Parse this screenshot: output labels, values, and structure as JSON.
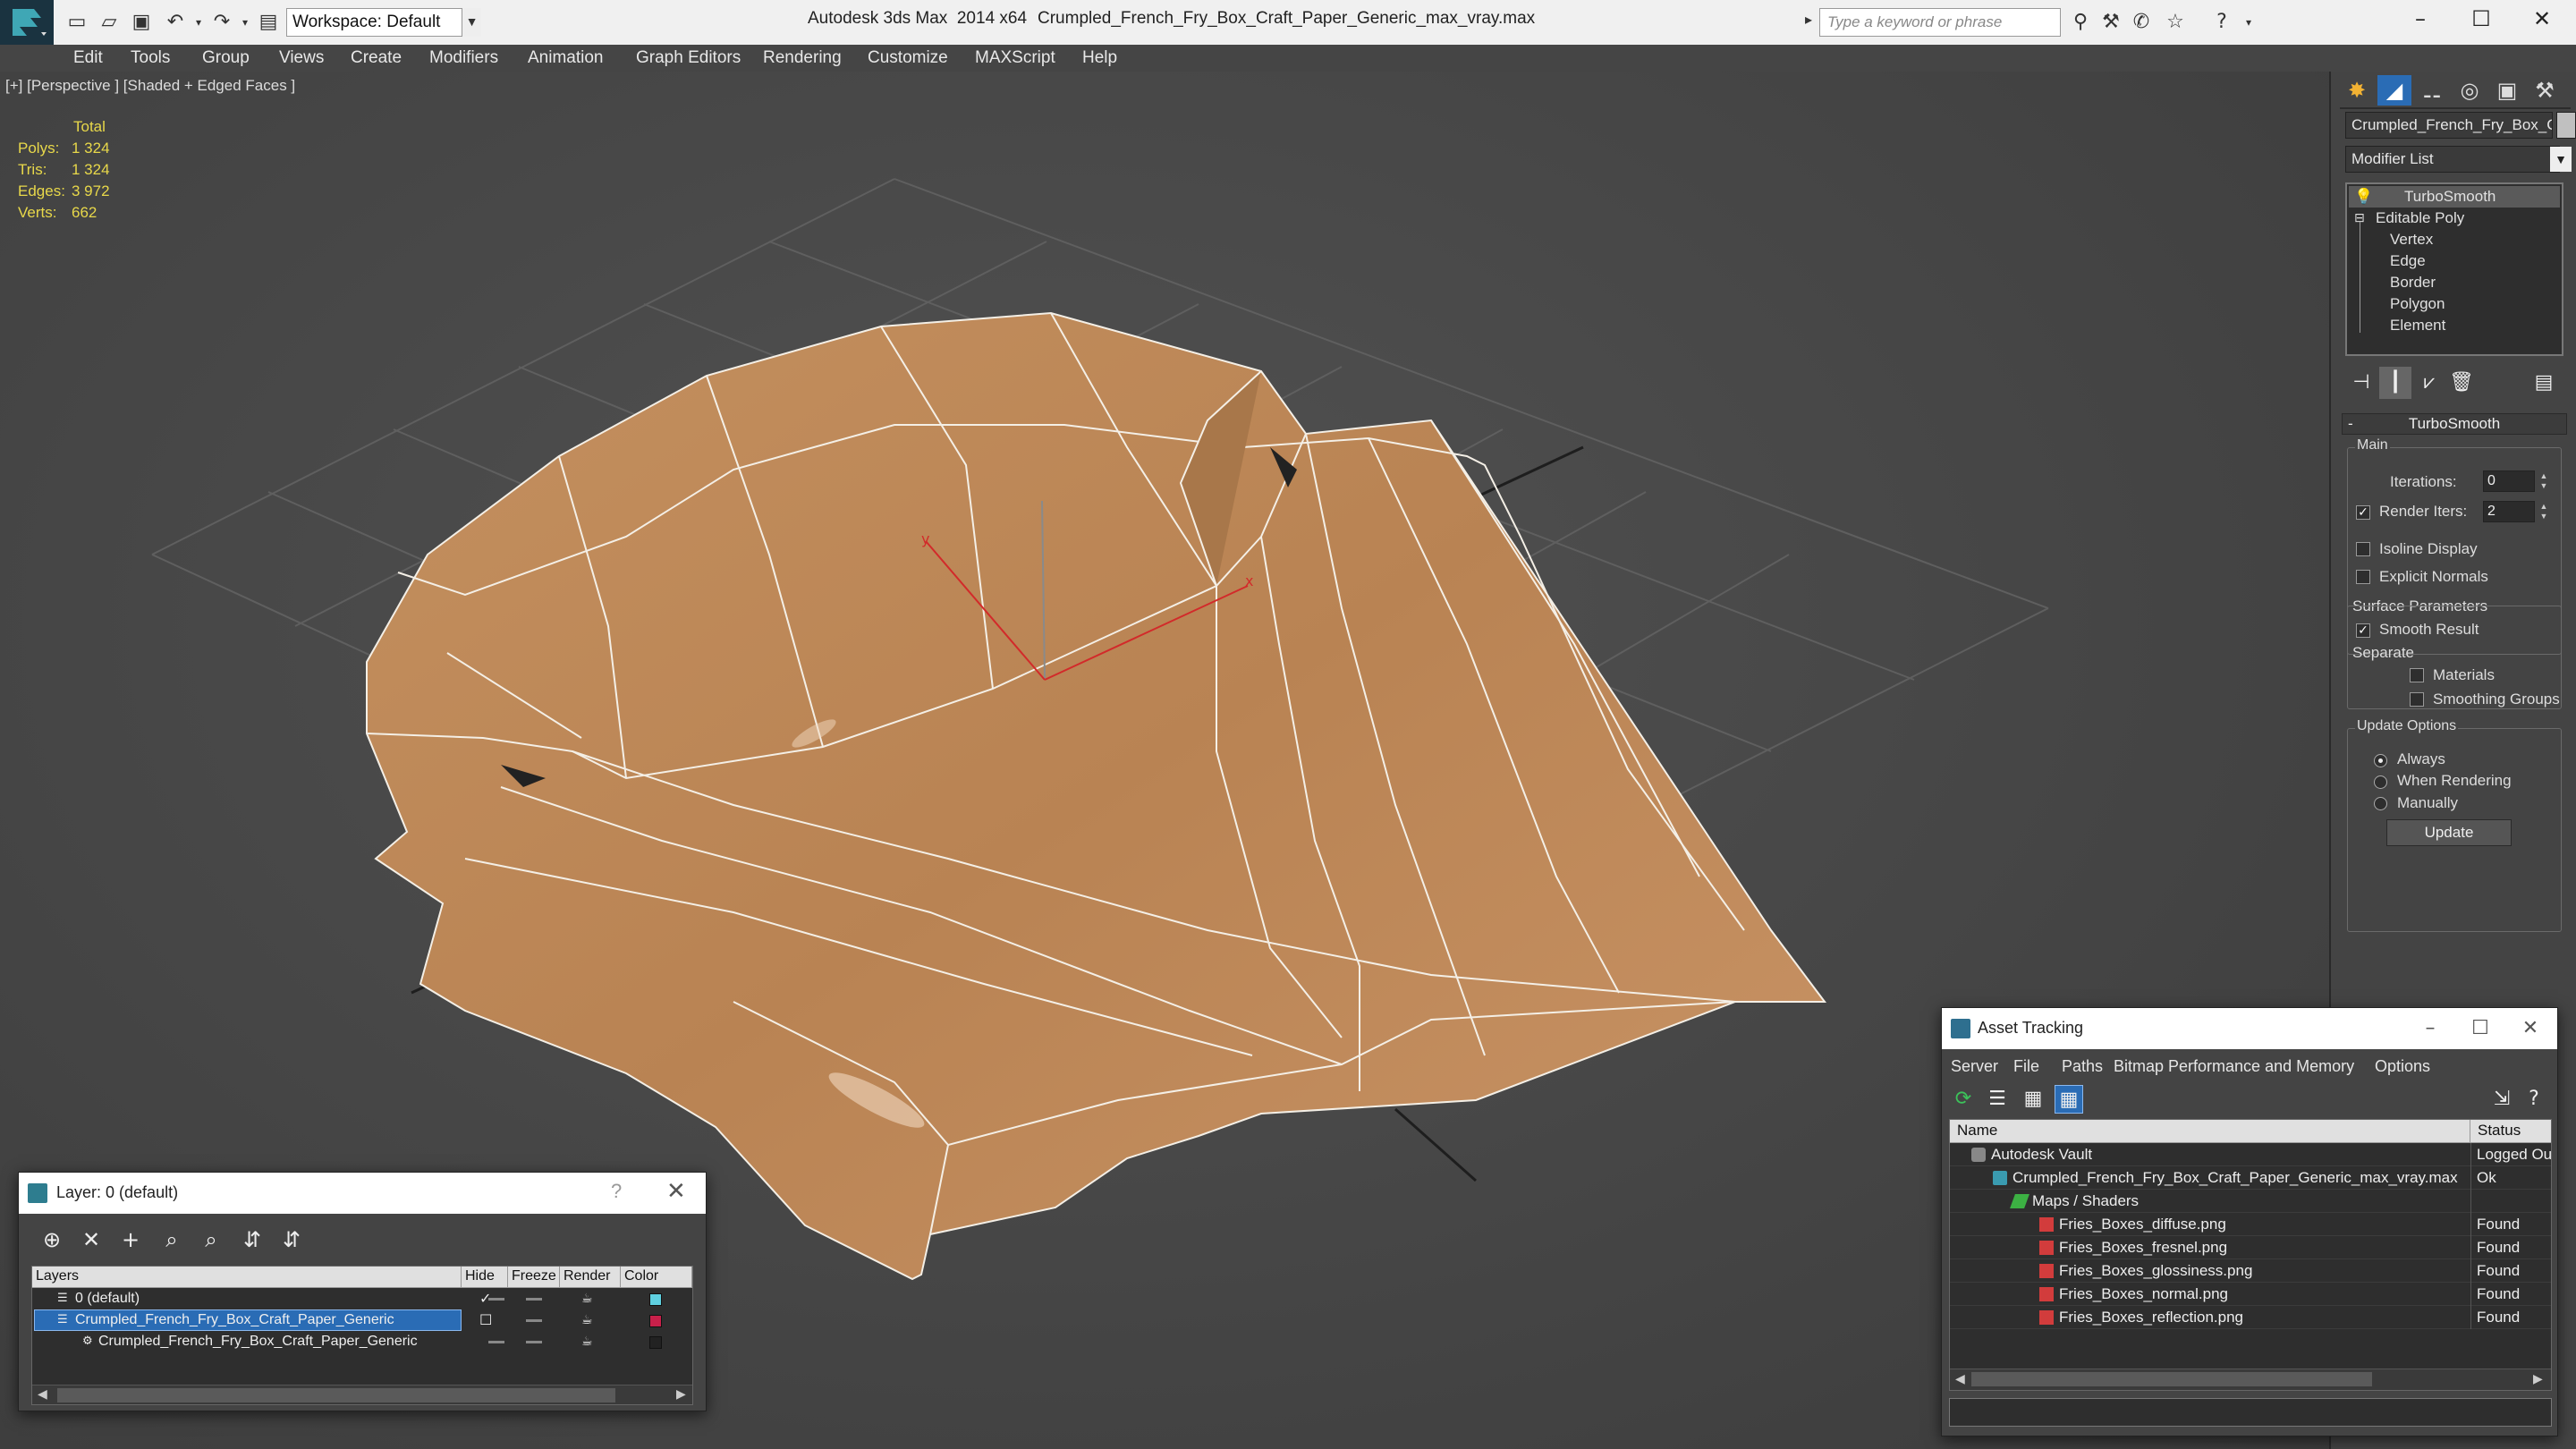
{
  "titlebar": {
    "workspace": "Workspace: Default",
    "app_title": "Autodesk 3ds Max  2014 x64",
    "file_title": "Crumpled_French_Fry_Box_Craft_Paper_Generic_max_vray.max",
    "search_placeholder": "Type a keyword or phrase"
  },
  "menu": [
    "Edit",
    "Tools",
    "Group",
    "Views",
    "Create",
    "Modifiers",
    "Animation",
    "Graph Editors",
    "Rendering",
    "Customize",
    "MAXScript",
    "Help"
  ],
  "viewport": {
    "label": "[+] [Perspective ] [Shaded + Edged Faces ]",
    "stats_header": "Total",
    "stats": [
      {
        "key": "Polys:",
        "value": "1 324"
      },
      {
        "key": "Tris:",
        "value": "1 324"
      },
      {
        "key": "Edges:",
        "value": "3 972"
      },
      {
        "key": "Verts:",
        "value": "662"
      }
    ],
    "axis_labels": {
      "x": "x",
      "y": "y"
    },
    "colors": {
      "mesh": "#c08a5c",
      "wire": "#f4efe6",
      "grid": "#5e5e5e",
      "axis_x": "#d22a2a"
    }
  },
  "command_panel": {
    "object_name": "Crumpled_French_Fry_Box_Craft_Paper_Generic",
    "modifier_list": "Modifier List",
    "stack": [
      "TurboSmooth",
      "Editable Poly",
      "Vertex",
      "Edge",
      "Border",
      "Polygon",
      "Element"
    ],
    "turbosmooth": {
      "title": "TurboSmooth",
      "main_label": "Main",
      "iterations_label": "Iterations:",
      "iterations_value": "0",
      "render_iters_label": "Render Iters:",
      "render_iters_value": "2",
      "isoline_label": "Isoline Display",
      "explicit_normals_label": "Explicit Normals",
      "surface_params_label": "Surface Parameters",
      "smooth_result_label": "Smooth Result",
      "separate_label": "Separate",
      "materials_label": "Materials",
      "smoothing_groups_label": "Smoothing Groups",
      "update_options_label": "Update Options",
      "always_label": "Always",
      "when_rendering_label": "When Rendering",
      "manually_label": "Manually",
      "update_button": "Update"
    }
  },
  "layer_dialog": {
    "title": "Layer: 0 (default)",
    "help": "?",
    "columns": [
      "Layers",
      "Hide",
      "Freeze",
      "Render",
      "Color"
    ],
    "rows": [
      {
        "name": "0 (default)",
        "color": "#5fd0e0"
      },
      {
        "name": "Crumpled_French_Fry_Box_Craft_Paper_Generic",
        "color": "#c8204a"
      },
      {
        "name": "Crumpled_French_Fry_Box_Craft_Paper_Generic",
        "color": "#222222"
      }
    ]
  },
  "asset_dialog": {
    "title": "Asset Tracking",
    "menu": [
      "Server",
      "File",
      "Paths",
      "Bitmap Performance and Memory",
      "Options"
    ],
    "columns": [
      "Name",
      "Status"
    ],
    "rows": [
      {
        "name": "Autodesk Vault",
        "status": "Logged Ou"
      },
      {
        "name": "Crumpled_French_Fry_Box_Craft_Paper_Generic_max_vray.max",
        "status": "Ok"
      },
      {
        "name": "Maps / Shaders",
        "status": ""
      },
      {
        "name": "Fries_Boxes_diffuse.png",
        "status": "Found"
      },
      {
        "name": "Fries_Boxes_fresnel.png",
        "status": "Found"
      },
      {
        "name": "Fries_Boxes_glossiness.png",
        "status": "Found"
      },
      {
        "name": "Fries_Boxes_normal.png",
        "status": "Found"
      },
      {
        "name": "Fries_Boxes_reflection.png",
        "status": "Found"
      }
    ]
  }
}
